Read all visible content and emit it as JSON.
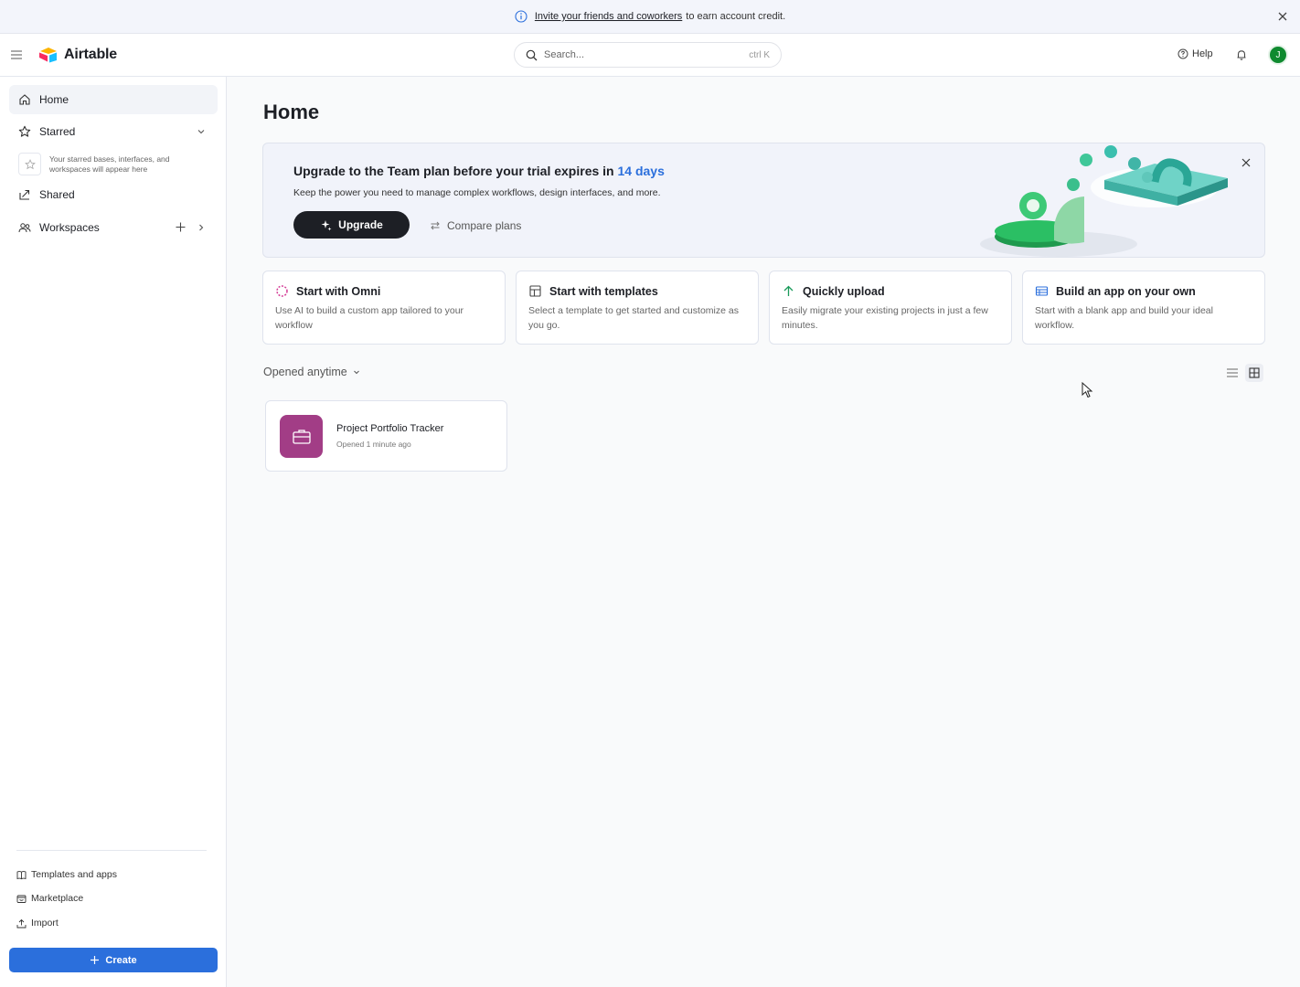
{
  "banner": {
    "link_text": "Invite your friends and coworkers",
    "text": "to earn account credit."
  },
  "header": {
    "brand": "Airtable",
    "search_placeholder": "Search...",
    "search_shortcut": "ctrl K",
    "help_label": "Help",
    "avatar_initial": "J"
  },
  "sidebar": {
    "home": "Home",
    "starred": "Starred",
    "starred_hint": "Your starred bases, interfaces, and workspaces will appear here",
    "shared": "Shared",
    "workspaces": "Workspaces",
    "templates": "Templates and apps",
    "marketplace": "Marketplace",
    "import": "Import",
    "create": "Create"
  },
  "main": {
    "title": "Home",
    "upgrade": {
      "title_prefix": "Upgrade to the Team plan before your trial expires in",
      "days": "14 days",
      "subtitle": "Keep the power you need to manage complex workflows, design interfaces, and more.",
      "button": "Upgrade",
      "compare": "Compare plans"
    },
    "quick_start": [
      {
        "title": "Start with Omni",
        "desc": "Use AI to build a custom app tailored to your workflow"
      },
      {
        "title": "Start with templates",
        "desc": "Select a template to get started and customize as you go."
      },
      {
        "title": "Quickly upload",
        "desc": "Easily migrate your existing projects in just a few minutes."
      },
      {
        "title": "Build an app on your own",
        "desc": "Start with a blank app and build your ideal workflow."
      }
    ],
    "filter_label": "Opened anytime",
    "bases": [
      {
        "name": "Project Portfolio Tracker",
        "meta": "Opened 1 minute ago",
        "color": "#a23d86"
      }
    ]
  },
  "colors": {
    "accent": "#2b6fdc",
    "create_button": "#2b6fdc",
    "upgrade_button": "#1d1f25",
    "avatar": "#0f8a2f"
  }
}
